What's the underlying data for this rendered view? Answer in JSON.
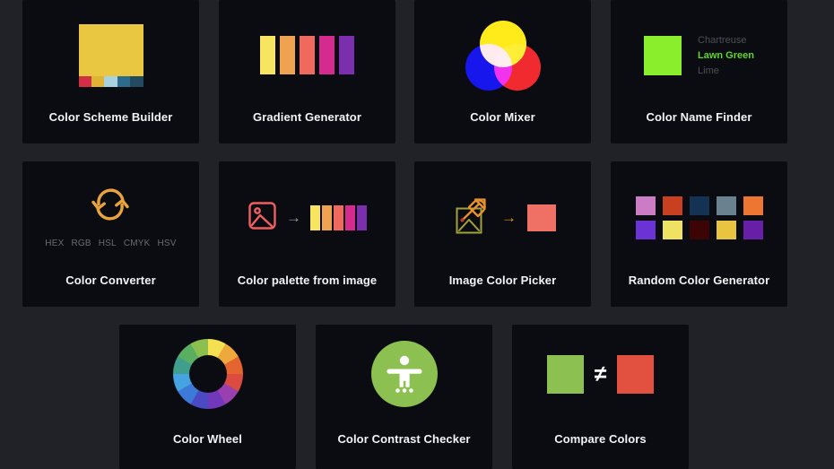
{
  "page": {
    "background_color": "#212227",
    "card_color": "#0b0c11",
    "title_color": "#f2f3f5"
  },
  "cards": [
    {
      "id": "color-scheme-builder",
      "title": "Color Scheme Builder",
      "icon": "color-scheme-swatches-icon",
      "main_color": "#e9c740",
      "swatches": [
        "#d13044",
        "#e0b335",
        "#a9d2e0",
        "#2d6b8c",
        "#234a5e"
      ]
    },
    {
      "id": "gradient-generator",
      "title": "Gradient Generator",
      "icon": "gradient-bars-icon",
      "swatches": [
        "#f7e45f",
        "#efa24f",
        "#f0695f",
        "#d62b8e",
        "#7b2fad"
      ]
    },
    {
      "id": "color-mixer",
      "title": "Color Mixer",
      "icon": "venn-circles-icon",
      "circles": [
        {
          "name": "yellow",
          "color": "#ffe90a"
        },
        {
          "name": "blue",
          "color": "#0b0bec"
        },
        {
          "name": "red",
          "color": "#f02020"
        }
      ]
    },
    {
      "id": "color-name-finder",
      "title": "Color Name Finder",
      "icon": "color-name-swatch-icon",
      "swatch_color": "#8aee2c",
      "names": [
        {
          "label": "Chartreuse",
          "active": false
        },
        {
          "label": "Lawn Green",
          "active": true
        },
        {
          "label": "Lime",
          "active": false
        }
      ],
      "active_color": "#5fd72b",
      "inactive_color": "#4d4f55"
    },
    {
      "id": "color-converter",
      "title": "Color Converter",
      "icon": "refresh-arrows-icon",
      "icon_color": "#e8a33c",
      "formats": [
        "HEX",
        "RGB",
        "HSL",
        "CMYK",
        "HSV"
      ]
    },
    {
      "id": "color-palette-from-image",
      "title": "Color palette from image",
      "icon": "image-to-palette-icon",
      "image_icon_color": "#ef5f5f",
      "arrow": "→",
      "swatches": [
        "#f7e45f",
        "#efa24f",
        "#f0695f",
        "#d62b8e",
        "#7b2fad"
      ]
    },
    {
      "id": "image-color-picker",
      "title": "Image Color Picker",
      "icon": "eyedropper-on-image-icon",
      "frame_color": "#a0a23a",
      "dropper_color": "#e8922e",
      "arrow": "→",
      "result_color": "#ef7064"
    },
    {
      "id": "random-color-generator",
      "title": "Random Color Generator",
      "icon": "random-swatch-grid-icon",
      "swatches": [
        "#cc7cc4",
        "#c8401f",
        "#143253",
        "#6a8190",
        "#ed7633",
        "#6b33d6",
        "#efe263",
        "#3c0404",
        "#e9c440",
        "#671fa8"
      ]
    },
    {
      "id": "color-wheel",
      "title": "Color Wheel",
      "icon": "color-wheel-icon",
      "segments": [
        "#f4e051",
        "#eda93c",
        "#e4652f",
        "#db4b3f",
        "#9a3fb0",
        "#7238bb",
        "#4a4bc3",
        "#3d79d6",
        "#44a3e0",
        "#3f9f8c",
        "#5aae62",
        "#8cc04e"
      ]
    },
    {
      "id": "color-contrast-checker",
      "title": "Color Contrast Checker",
      "icon": "accessibility-person-icon",
      "circle_color": "#8cc051",
      "glyph_color": "#ffffff"
    },
    {
      "id": "compare-colors",
      "title": "Compare Colors",
      "icon": "not-equal-compare-icon",
      "left_color": "#8cc051",
      "right_color": "#e2503f",
      "operator": "≠"
    }
  ]
}
